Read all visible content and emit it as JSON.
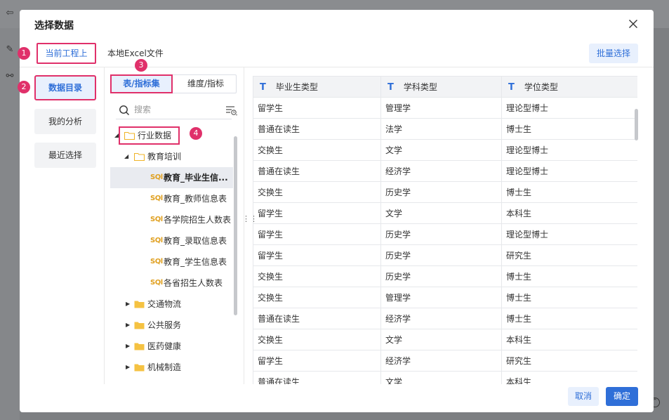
{
  "dialog": {
    "title": "选择数据"
  },
  "source_tabs": [
    {
      "label": "当前工程上",
      "active": true
    },
    {
      "label": "本地Excel文件",
      "active": false
    }
  ],
  "batch_select_label": "批量选择",
  "left_nav": [
    {
      "label": "数据目录",
      "active": true
    },
    {
      "label": "我的分析",
      "active": false
    },
    {
      "label": "最近选择",
      "active": false
    }
  ],
  "view_tabs": [
    {
      "label": "表/指标集",
      "active": true
    },
    {
      "label": "维度/指标",
      "active": false
    }
  ],
  "search": {
    "placeholder": "搜索",
    "value": ""
  },
  "tree": [
    {
      "label": "行业数据",
      "type": "folder",
      "expanded": true,
      "level": 0
    },
    {
      "label": "教育培训",
      "type": "folder",
      "expanded": true,
      "level": 1
    },
    {
      "label": "教育_毕业生信...",
      "type": "sql",
      "level": 2,
      "selected": true
    },
    {
      "label": "教育_教师信息表",
      "type": "sql",
      "level": 2
    },
    {
      "label": "各学院招生人数表",
      "type": "sql",
      "level": 2
    },
    {
      "label": "教育_录取信息表",
      "type": "sql",
      "level": 2
    },
    {
      "label": "教育_学生信息表",
      "type": "sql",
      "level": 2
    },
    {
      "label": "各省招生人数表",
      "type": "sql",
      "level": 2
    },
    {
      "label": "交通物流",
      "type": "folder",
      "expanded": false,
      "level": 1
    },
    {
      "label": "公共服务",
      "type": "folder",
      "expanded": false,
      "level": 1
    },
    {
      "label": "医药健康",
      "type": "folder",
      "expanded": false,
      "level": 1
    },
    {
      "label": "机械制造",
      "type": "folder",
      "expanded": false,
      "level": 1
    }
  ],
  "grid": {
    "type_icon": "T",
    "columns": [
      "毕业生类型",
      "学科类型",
      "学位类型"
    ],
    "rows": [
      [
        "留学生",
        "管理学",
        "理论型博士"
      ],
      [
        "普通在读生",
        "法学",
        "博士生"
      ],
      [
        "交换生",
        "文学",
        "理论型博士"
      ],
      [
        "普通在读生",
        "经济学",
        "理论型博士"
      ],
      [
        "交换生",
        "历史学",
        "博士生"
      ],
      [
        "留学生",
        "文学",
        "本科生"
      ],
      [
        "留学生",
        "历史学",
        "理论型博士"
      ],
      [
        "留学生",
        "历史学",
        "研究生"
      ],
      [
        "交换生",
        "历史学",
        "博士生"
      ],
      [
        "交换生",
        "管理学",
        "博士生"
      ],
      [
        "普通在读生",
        "经济学",
        "博士生"
      ],
      [
        "交换生",
        "文学",
        "本科生"
      ],
      [
        "留学生",
        "经济学",
        "研究生"
      ],
      [
        "普通在读生",
        "文学",
        "本科生"
      ]
    ]
  },
  "footer": {
    "cancel_label": "取消",
    "ok_label": "确定"
  },
  "badges": [
    "1",
    "2",
    "3",
    "4"
  ],
  "colors": {
    "accent": "#2f6fd8",
    "highlight": "#e0306a",
    "sql_icon": "#e0a020",
    "folder": "#f5c242"
  },
  "icons": {
    "sql": "SQl"
  }
}
